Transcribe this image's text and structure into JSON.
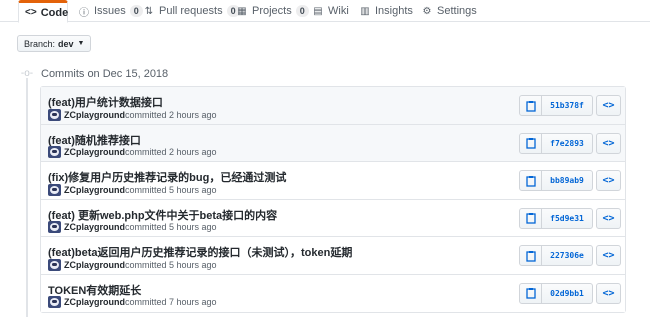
{
  "tabs": [
    {
      "label": "Code",
      "icon": "code-icon",
      "glyph": "<>",
      "selected": true
    },
    {
      "label": "Issues",
      "icon": "issue-icon",
      "glyph": "ⓘ",
      "count": "0"
    },
    {
      "label": "Pull requests",
      "icon": "pull-request-icon",
      "glyph": "⇅",
      "count": "0"
    },
    {
      "label": "Projects",
      "icon": "project-icon",
      "glyph": "▦",
      "count": "0"
    },
    {
      "label": "Wiki",
      "icon": "book-icon",
      "glyph": "▤"
    },
    {
      "label": "Insights",
      "icon": "graph-icon",
      "glyph": "▥"
    },
    {
      "label": "Settings",
      "icon": "gear-icon",
      "glyph": "⚙"
    }
  ],
  "branch": {
    "prefix": "Branch:",
    "name": "dev"
  },
  "commit_group": {
    "date_label": "Commits on Dec 15, 2018"
  },
  "commits": [
    {
      "message": "(feat)用户统计数据接口",
      "author": "ZCplayground",
      "meta": "committed 2 hours ago",
      "sha": "51b378f"
    },
    {
      "message": "(feat)随机推荐接口",
      "author": "ZCplayground",
      "meta": "committed 2 hours ago",
      "sha": "f7e2893"
    },
    {
      "message": "(fix)修复用户历史推荐记录的bug，已经通过测试",
      "author": "ZCplayground",
      "meta": "committed 5 hours ago",
      "sha": "bb89ab9"
    },
    {
      "message": "(feat) 更新web.php文件中关于beta接口的内容",
      "author": "ZCplayground",
      "meta": "committed 5 hours ago",
      "sha": "f5d9e31"
    },
    {
      "message": "(feat)beta返回用户历史推荐记录的接口（未测试），token延期",
      "author": "ZCplayground",
      "meta": "committed 5 hours ago",
      "sha": "227306e"
    },
    {
      "message": "TOKEN有效期延长",
      "author": "ZCplayground",
      "meta": "committed 7 hours ago",
      "sha": "02d9bb1"
    }
  ],
  "browse_label": "<>",
  "colors": {
    "accent_tab": "#e36209",
    "link": "#0366d6",
    "highlight_row": "#f6f8fa"
  }
}
